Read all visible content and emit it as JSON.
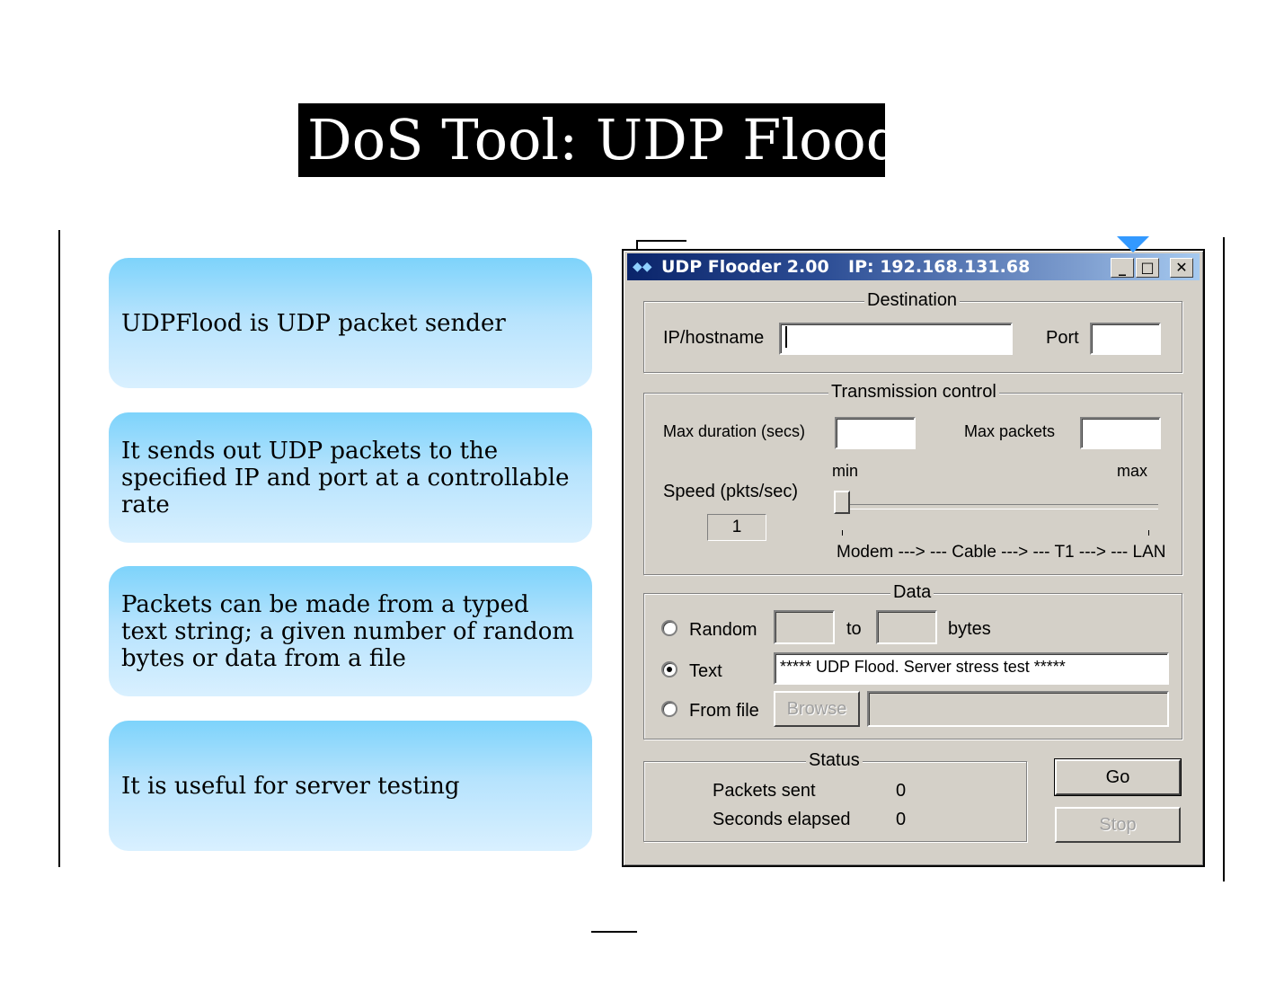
{
  "slide": {
    "title": "DoS Tool: UDP Flood",
    "bullets": [
      "UDPFlood is UDP packet sender",
      "It sends out UDP packets to the specified IP and port at a controllable rate",
      "Packets can be made from a typed text string; a given number of random bytes or data from a file",
      "It is useful for server testing"
    ]
  },
  "window": {
    "title": "UDP Flooder 2.00",
    "ip": "IP: 192.168.131.68",
    "icon": "udp-flooder-app-icon",
    "controls": {
      "minimize": "_",
      "maximize": "□",
      "close": "✕"
    }
  },
  "destination": {
    "legend": "Destination",
    "ip_label": "IP/hostname",
    "ip_value": "",
    "port_label": "Port",
    "port_value": ""
  },
  "transmission": {
    "legend": "Transmission control",
    "max_duration_label": "Max duration (secs)",
    "max_duration_value": "",
    "max_packets_label": "Max packets",
    "max_packets_value": "",
    "speed_label": "Speed (pkts/sec)",
    "speed_value": "1",
    "slider_min": "min",
    "slider_max": "max",
    "slider_scale": "Modem ---> --- Cable ---> --- T1 ---> --- LAN",
    "slider_level": 0
  },
  "data": {
    "legend": "Data",
    "random_label": "Random",
    "random_from": "",
    "to_label": "to",
    "random_to": "",
    "bytes_label": "bytes",
    "text_label": "Text",
    "text_value": "***** UDP Flood. Server stress test *****",
    "file_label": "From file",
    "browse_label": "Browse",
    "file_value": "",
    "selected": "Text"
  },
  "status": {
    "legend": "Status",
    "packets_sent_label": "Packets sent",
    "packets_sent_value": "0",
    "seconds_elapsed_label": "Seconds elapsed",
    "seconds_elapsed_value": "0"
  },
  "actions": {
    "go_label": "Go",
    "stop_label": "Stop"
  }
}
